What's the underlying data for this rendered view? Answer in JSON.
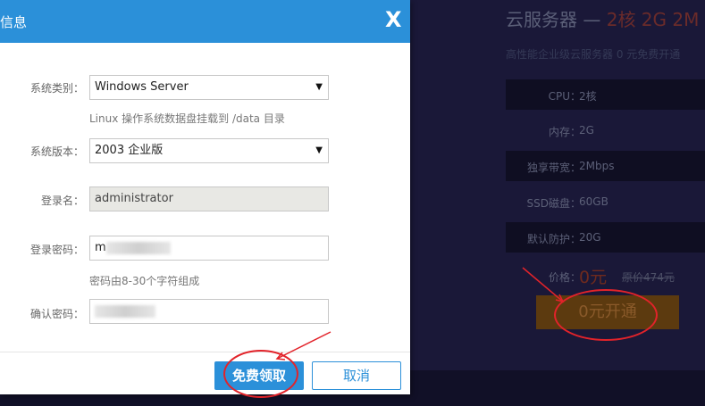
{
  "modal": {
    "title": "信息",
    "close_label": "X",
    "fields": {
      "os_type_label": "系统类别：",
      "os_type_value": "Windows Server",
      "os_hint": "Linux 操作系统数据盘挂载到 /data 目录",
      "os_version_label": "系统版本：",
      "os_version_value": "2003 企业版",
      "login_label": "登录名：",
      "login_value": "administrator",
      "password_label": "登录密码：",
      "password_visible_prefix": "m",
      "password_hint": "密码由8-30个字符组成",
      "confirm_label": "确认密码："
    },
    "buttons": {
      "claim": "免费领取",
      "cancel": "取消"
    }
  },
  "product": {
    "title_prefix": "云服务器 — ",
    "title_highlight": "2核 2G 2M",
    "subtitle": "高性能企业级云服务器 0 元免费开通",
    "specs": [
      {
        "label": "CPU：",
        "value": "2核"
      },
      {
        "label": "内存：",
        "value": "2G"
      },
      {
        "label": "独享带宽：",
        "value": "2Mbps"
      },
      {
        "label": "SSD磁盘：",
        "value": "60GB"
      },
      {
        "label": "默认防护：",
        "value": "20G"
      }
    ],
    "price_label": "价格：",
    "price": "0元",
    "original_price": "原价474元",
    "open_button": "0元开通"
  },
  "colors": {
    "accent": "#2b90d9",
    "annotation": "#e2232a",
    "backdrop": "#1a1838"
  }
}
